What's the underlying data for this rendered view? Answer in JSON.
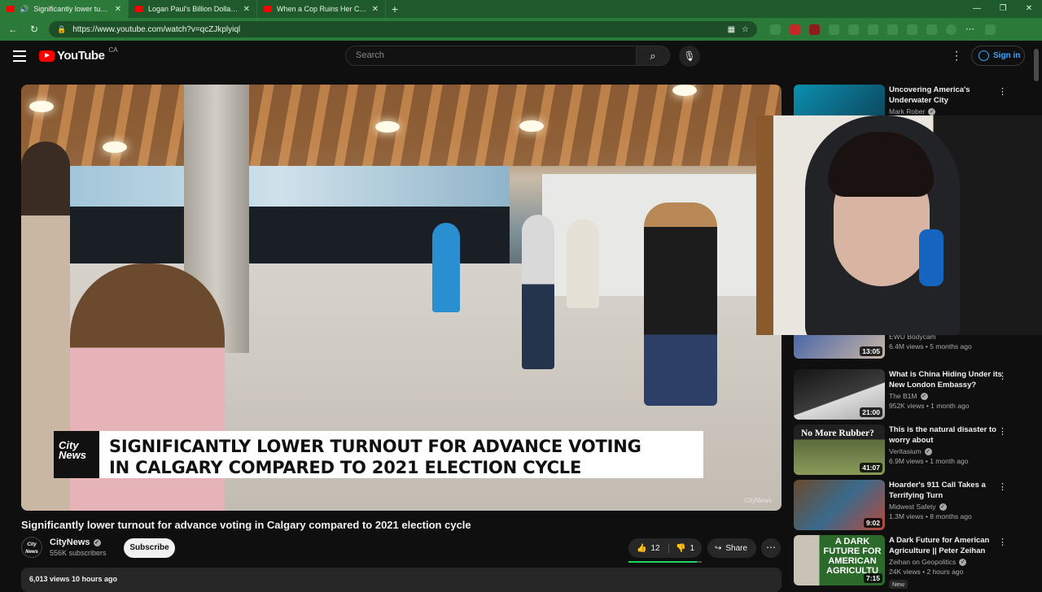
{
  "browser": {
    "tabs": [
      {
        "title": "Significantly lower turnout fo...",
        "active": true
      },
      {
        "title": "Logan Paul's Billion Dollar PRIME",
        "active": false
      },
      {
        "title": "When a Cop Ruins Her Career In",
        "active": false
      }
    ],
    "url": "https://www.youtube.com/watch?v=qcZJkplyiql"
  },
  "masthead": {
    "logo": "YouTube",
    "country": "CA",
    "search_placeholder": "Search",
    "signin": "Sign in"
  },
  "video": {
    "lower_third_logo": "City News",
    "lower_third_line1": "SIGNIFICANTLY LOWER TURNOUT FOR ADVANCE VOTING",
    "lower_third_line2": "IN CALGARY COMPARED TO 2021 ELECTION CYCLE",
    "watermark": "CityNews",
    "title": "Significantly lower turnout for advance voting in Calgary compared to 2021 election cycle",
    "channel": "CityNews",
    "subscribers": "556K subscribers",
    "subscribe": "Subscribe",
    "likes": "12",
    "dislikes": "1",
    "share": "Share",
    "views_line": "6,013 views  10 hours ago",
    "channel_avatar": "City News"
  },
  "sidebar": [
    {
      "title": "Uncovering America's Underwater City",
      "channel": "Mark Rober",
      "meta": "",
      "duration": ""
    },
    {
      "title": "",
      "channel": "EWU Bodycam",
      "meta": "6.4M views • 5 months ago",
      "duration": "13:05"
    },
    {
      "title": "What is China Hiding Under its New London Embassy?",
      "channel": "The B1M",
      "meta": "952K views • 1 month ago",
      "duration": "21:00"
    },
    {
      "title": "This is the natural disaster to worry about",
      "channel": "Veritasium",
      "meta": "6.9M views • 1 month ago",
      "duration": "41:07",
      "thumb_text": "No More Rubber?"
    },
    {
      "title": "Hoarder's 911 Call Takes a Terrifying Turn",
      "channel": "Midwest Safety",
      "meta": "1.3M views • 8 months ago",
      "duration": "9:02"
    },
    {
      "title": "A Dark Future for American Agriculture || Peter Zeihan",
      "channel": "Zeihan on Geopolitics",
      "meta": "24K views • 2 hours ago",
      "duration": "7:15",
      "badge": "New",
      "thumb_text": "A DARK FUTURE FOR AMERICAN AGRICULTU"
    }
  ],
  "colors": {
    "accent": "#3ea6ff",
    "brand": "#ff0000",
    "browser_frame": "#2c7a3a"
  }
}
